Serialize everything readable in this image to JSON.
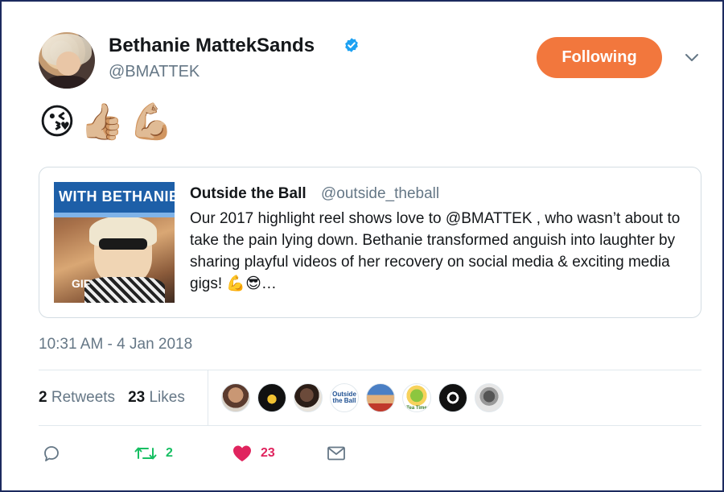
{
  "tweet": {
    "author": {
      "name": "Bethanie MattekSands",
      "handle": "@BMATTEK",
      "verified": true
    },
    "follow_label": "Following",
    "body_emojis": [
      "😘",
      "👍🏼",
      "💪🏼"
    ],
    "timestamp": "10:31 AM - 4 Jan 2018"
  },
  "quoted": {
    "name": "Outside the Ball",
    "handle": "@outside_theball",
    "text": "Our 2017 highlight reel shows love to @BMATTEK , who wasn’t about to take the pain lying down. Bethanie transformed anguish into laughter by sharing playful videos of her recovery on social media & exciting media gigs! 💪😎…",
    "media": {
      "banner_text": "WITH BETHANIE",
      "badge": "GIF"
    }
  },
  "stats": {
    "retweets_count": "2",
    "retweets_label": "Retweets",
    "likes_count": "23",
    "likes_label": "Likes"
  },
  "likers": [
    {
      "name": "liker-1"
    },
    {
      "name": "liker-2"
    },
    {
      "name": "liker-3"
    },
    {
      "name": "liker-4",
      "text": "Outside the Ball"
    },
    {
      "name": "liker-5"
    },
    {
      "name": "liker-6",
      "text": "Tea Time"
    },
    {
      "name": "liker-7"
    },
    {
      "name": "liker-8"
    }
  ],
  "actions": {
    "reply_icon": "reply-icon",
    "retweet_icon": "retweet-icon",
    "retweet_count": "2",
    "like_icon": "heart-icon",
    "like_count": "23",
    "dm_icon": "envelope-icon"
  },
  "colors": {
    "accent_orange": "#f2773d",
    "verified_blue": "#1da1f2",
    "retweet_green": "#17bf63",
    "like_red": "#e0245e",
    "secondary_text": "#657786",
    "frame_border": "#1c2a5e"
  }
}
